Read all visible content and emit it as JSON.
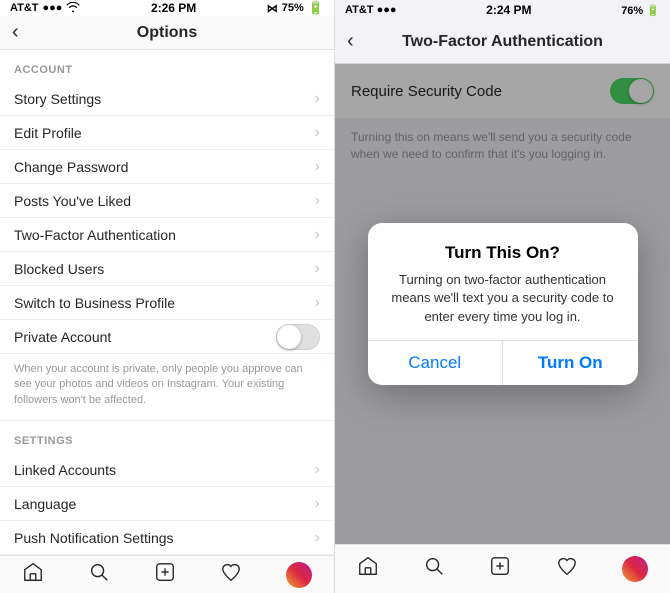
{
  "left": {
    "status_bar": {
      "carrier": "AT&T",
      "signal": "●●●○○",
      "wifi": "WiFi",
      "time": "2:26 PM",
      "bluetooth": "BT",
      "battery_icon": "75%"
    },
    "nav": {
      "title": "Options",
      "back_icon": "‹"
    },
    "account_section": {
      "header": "ACCOUNT",
      "items": [
        {
          "label": "Story Settings",
          "id": "story-settings"
        },
        {
          "label": "Edit Profile",
          "id": "edit-profile"
        },
        {
          "label": "Change Password",
          "id": "change-password"
        },
        {
          "label": "Posts You've Liked",
          "id": "posts-liked"
        },
        {
          "label": "Two-Factor Authentication",
          "id": "two-factor"
        },
        {
          "label": "Blocked Users",
          "id": "blocked-users"
        },
        {
          "label": "Switch to Business Profile",
          "id": "business-profile"
        }
      ]
    },
    "private_account": {
      "label": "Private Account",
      "description": "When your account is private, only people you approve can see your photos and videos on Instagram. Your existing followers won't be affected."
    },
    "settings_section": {
      "header": "SETTINGS",
      "items": [
        {
          "label": "Linked Accounts",
          "id": "linked-accounts"
        },
        {
          "label": "Language",
          "id": "language"
        },
        {
          "label": "Push Notification Settings",
          "id": "push-notifications"
        }
      ]
    },
    "tab_bar": {
      "icons": [
        "home",
        "search",
        "add",
        "heart",
        "profile"
      ]
    }
  },
  "right": {
    "status_bar": {
      "carrier": "AT&T",
      "time": "2:24 PM",
      "battery": "76%"
    },
    "nav": {
      "title": "Two-Factor Authentication",
      "back_icon": "‹"
    },
    "security_row": {
      "label": "Require Security Code"
    },
    "security_desc": "Turning this on means we'll send you a security code when we need to confirm that it's you logging in.",
    "modal": {
      "title": "Turn This On?",
      "description": "Turning on two-factor authentication means we'll text you a security code to enter every time you log in.",
      "cancel_label": "Cancel",
      "confirm_label": "Turn On"
    },
    "tab_bar": {
      "icons": [
        "home",
        "search",
        "add",
        "heart",
        "profile"
      ]
    }
  }
}
